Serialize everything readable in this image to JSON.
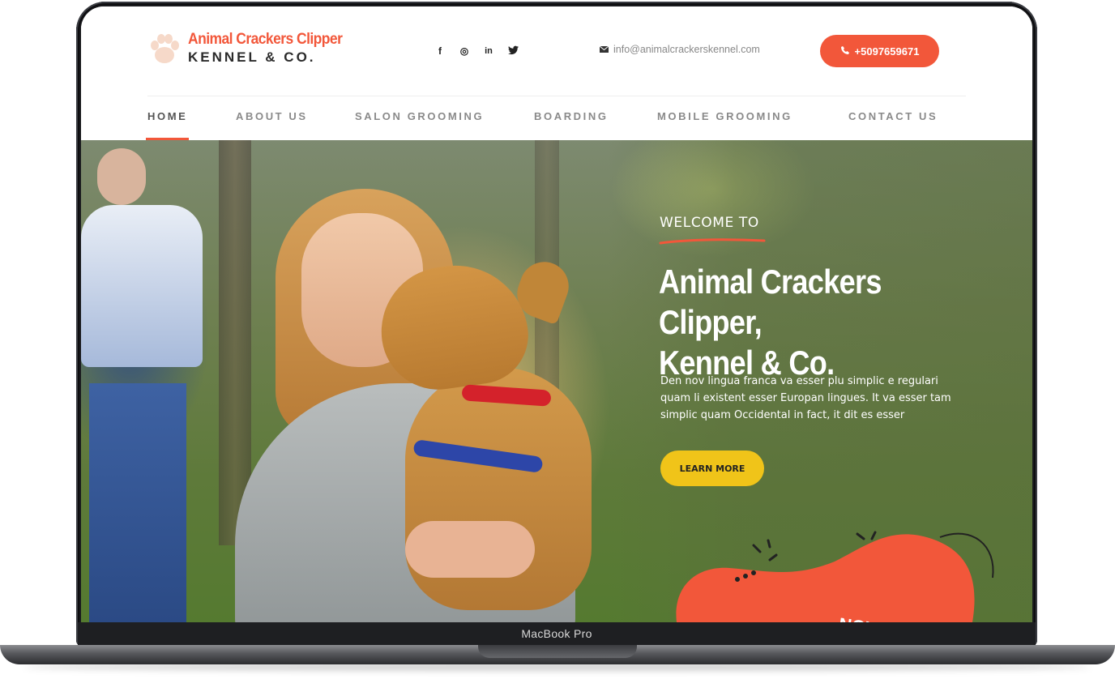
{
  "device": {
    "label": "MacBook Pro"
  },
  "brand": {
    "line1": "Animal Crackers Clipper",
    "line2": "KENNEL & CO.",
    "accent": "#f2573a",
    "dark": "#2b2b2b"
  },
  "social": [
    {
      "name": "facebook",
      "glyph": "f"
    },
    {
      "name": "instagram",
      "glyph": "◎"
    },
    {
      "name": "linkedin",
      "glyph": "in"
    },
    {
      "name": "twitter",
      "glyph": "🐦"
    }
  ],
  "contact": {
    "email": "info@animalcrackerskennel.com",
    "phone": "+5097659671"
  },
  "nav": [
    {
      "label": "HOME",
      "active": true
    },
    {
      "label": "ABOUT US"
    },
    {
      "label": "SALON GROOMING"
    },
    {
      "label": "BOARDING"
    },
    {
      "label": "MOBILE GROOMING"
    },
    {
      "label": "CONTACT US"
    }
  ],
  "hero": {
    "kicker": "WELCOME TO",
    "title_line1": "Animal Crackers Clipper,",
    "title_line2": "Kennel & Co.",
    "text": "Den nov lingua franca va esser plu simplic e regulari quam li existent esser Europan lingues. It va esser tam simplic quam Occidental in fact, it dit es  esser",
    "cta": "LEARN MORE",
    "badge_text": "NOW"
  },
  "colors": {
    "cta": "#f0c419",
    "phone_btn": "#f2573a"
  }
}
